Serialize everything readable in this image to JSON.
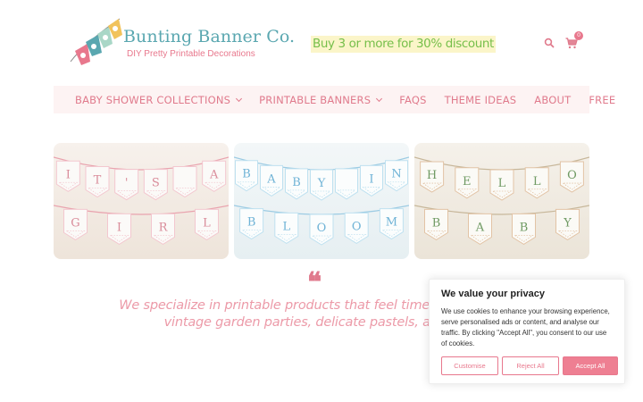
{
  "brand": {
    "title": "Bunting Banner Co.",
    "tagline": "DIY Pretty Printable Decorations"
  },
  "promo": "Buy 3 or more for 30% discount",
  "header_icons": {
    "search": "search-icon",
    "cart": "cart-icon",
    "cart_count": "0"
  },
  "nav": {
    "items": [
      {
        "label": "BABY SHOWER COLLECTIONS",
        "dropdown": true
      },
      {
        "label": "PRINTABLE BANNERS",
        "dropdown": true
      },
      {
        "label": "FAQS",
        "dropdown": false
      },
      {
        "label": "THEME IDEAS",
        "dropdown": false
      },
      {
        "label": "ABOUT",
        "dropdown": false
      },
      {
        "label": "FREE",
        "dropdown": false
      }
    ]
  },
  "gallery": [
    {
      "line1": [
        "I",
        "T",
        "'",
        "S",
        " ",
        "A"
      ],
      "line2": [
        "G",
        "I",
        "R",
        "L"
      ],
      "theme": "pink"
    },
    {
      "line1": [
        "B",
        "A",
        "B",
        "Y",
        " ",
        "I",
        "N"
      ],
      "line2": [
        "B",
        "L",
        "O",
        "O",
        "M"
      ],
      "theme": "blue"
    },
    {
      "line1": [
        "H",
        "E",
        "L",
        "L",
        "O"
      ],
      "line2": [
        "B",
        "A",
        "B",
        "Y"
      ],
      "theme": "green"
    }
  ],
  "quote": {
    "mark": "❝",
    "line1": "We specialize in printable products that feel timeless and pretty",
    "line2": "vintage garden parties, delicate pastels, and drea"
  },
  "cookie": {
    "title": "We value your privacy",
    "text": "We use cookies to enhance your browsing experience, serve personalised ads or content, and analyse our traffic. By clicking \"Accept All\", you consent to our use of cookies.",
    "customise": "Customise",
    "reject": "Reject All",
    "accept": "Accept All"
  },
  "colors": {
    "accent": "#e07a8c",
    "teal": "#5aa7b0",
    "promo_green": "#76bf4a",
    "promo_bg": "#fbf5c9"
  }
}
